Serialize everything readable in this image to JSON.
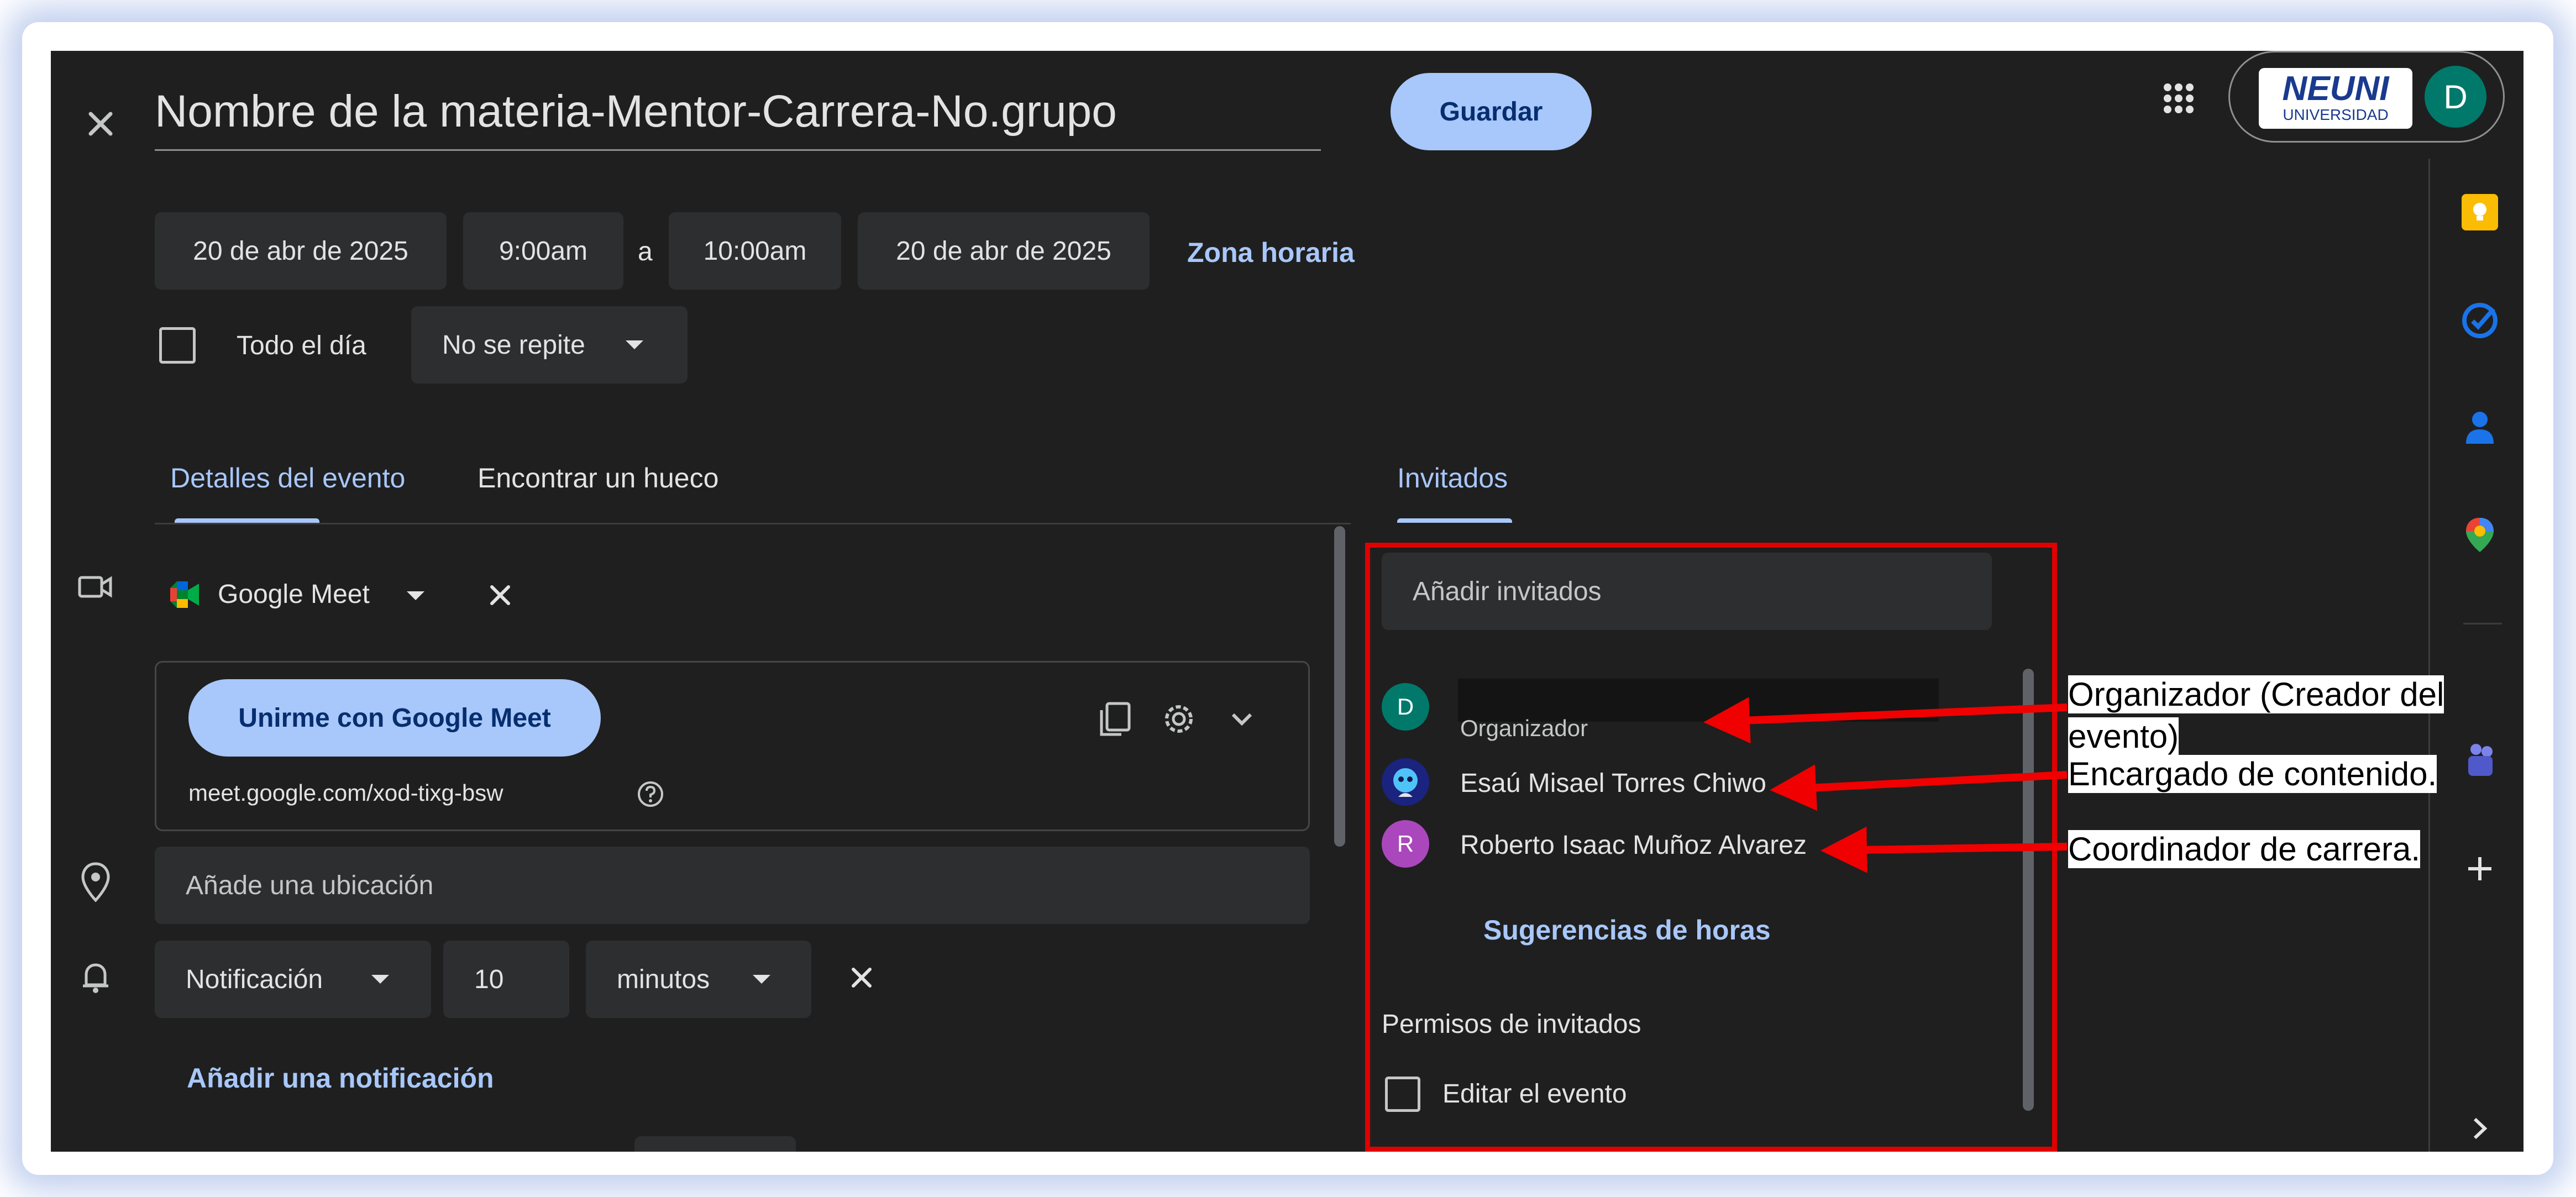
{
  "event": {
    "title": "Nombre de la materia-Mentor-Carrera-No.grupo",
    "save_label": "Guardar",
    "start_date": "20 de abr de 2025",
    "start_time": "9:00am",
    "to_label": "a",
    "end_time": "10:00am",
    "end_date": "20 de abr de 2025",
    "timezone_label": "Zona horaria",
    "all_day_label": "Todo el día",
    "repeat_value": "No se repite"
  },
  "header": {
    "brand_logo": "NEUNI",
    "brand_sub": "UNIVERSIDAD",
    "account_initial": "D"
  },
  "tabs": {
    "details": "Detalles del evento",
    "find_slot": "Encontrar un hueco",
    "guests": "Invitados"
  },
  "conference": {
    "provider": "Google Meet",
    "join_label": "Unirme con Google Meet",
    "link": "meet.google.com/xod-tixg-bsw"
  },
  "location": {
    "placeholder": "Añade una ubicación"
  },
  "notification": {
    "type": "Notificación",
    "amount": "10",
    "unit": "minutos",
    "add_label": "Añadir una notificación"
  },
  "guests": {
    "add_placeholder": "Añadir invitados",
    "list": [
      {
        "initial": "D",
        "name": "",
        "role": "Organizador",
        "color": "#00796b"
      },
      {
        "initial": "",
        "name": "Esaú Misael Torres Chiwo",
        "role": "",
        "color": "#1a237e"
      },
      {
        "initial": "R",
        "name": "Roberto Isaac Muñoz Alvarez",
        "role": "",
        "color": "#ab47bc"
      }
    ],
    "suggestions_label": "Sugerencias de horas",
    "permissions_title": "Permisos de invitados",
    "perm_edit": "Editar el evento"
  },
  "annotations": {
    "organizer_line1": "Organizador (Creador del",
    "organizer_line2": "evento)",
    "content_manager": "Encargado de contenido.",
    "coordinator": "Coordinador de carrera."
  },
  "colors": {
    "background": "#1f1f1f",
    "accent": "#a8c7fa",
    "highlight_box": "#e00000",
    "arrow": "#f00000"
  },
  "icons": [
    "close-icon",
    "apps-grid-icon",
    "keep-icon",
    "tasks-icon",
    "contacts-icon",
    "maps-icon",
    "teams-icon",
    "add-icon",
    "chevron-right-icon",
    "video-icon",
    "location-icon",
    "bell-icon",
    "copy-icon",
    "gear-icon",
    "chevron-down-icon",
    "help-icon"
  ]
}
